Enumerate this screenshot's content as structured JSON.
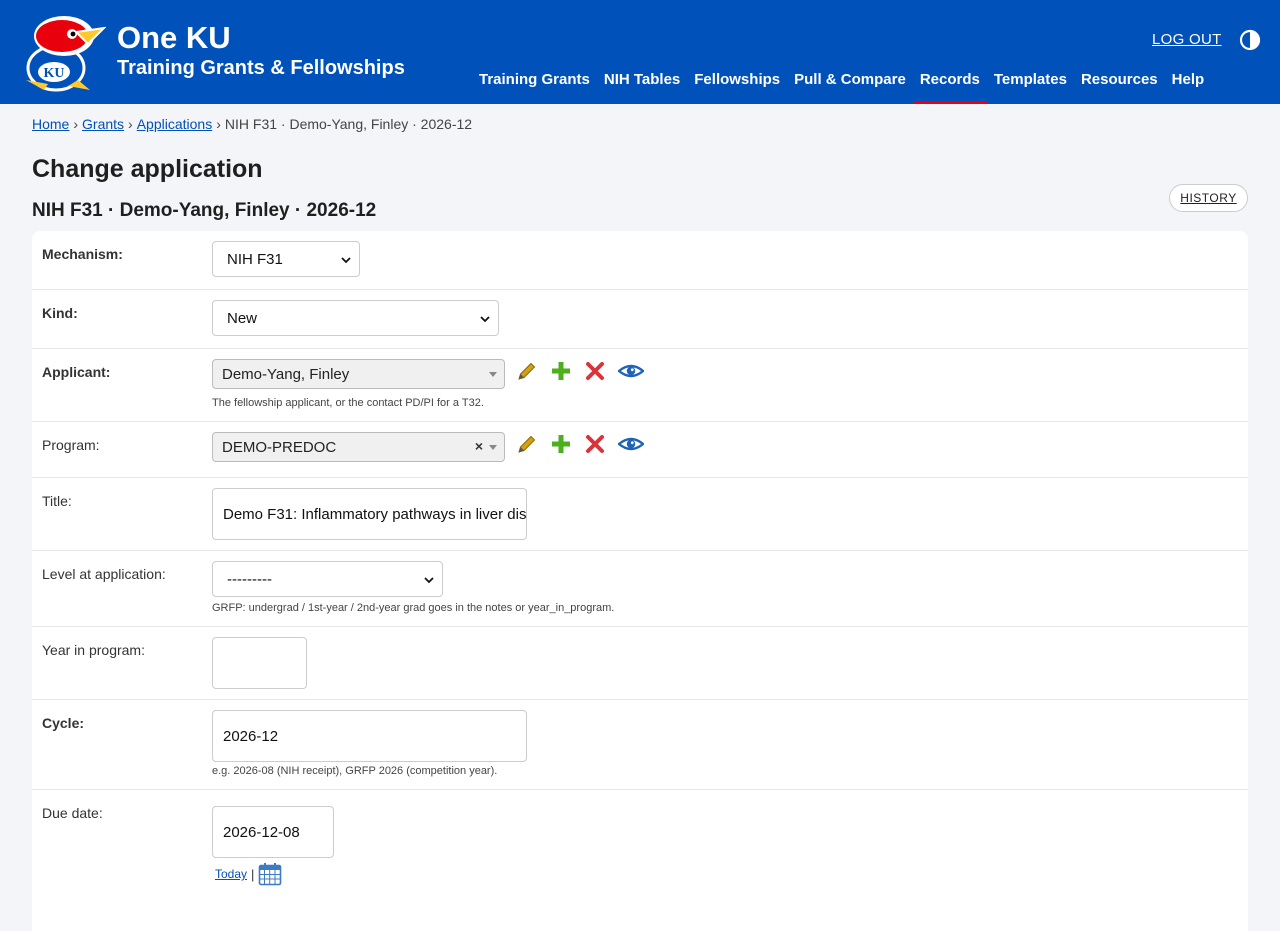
{
  "header": {
    "brand_title": "One KU",
    "brand_subtitle": "Training Grants & Fellowships",
    "logout_label": "LOG OUT",
    "nav": [
      {
        "label": "Training Grants"
      },
      {
        "label": "NIH Tables"
      },
      {
        "label": "Fellowships"
      },
      {
        "label": "Pull & Compare"
      },
      {
        "label": "Records"
      },
      {
        "label": "Templates"
      },
      {
        "label": "Resources"
      },
      {
        "label": "Help"
      }
    ],
    "active_nav": "Records",
    "logo_text": "KU",
    "colors": {
      "brand_blue": "#0051ba",
      "active_underline": "#e8000d"
    }
  },
  "breadcrumb": {
    "home": "Home",
    "grants": "Grants",
    "applications": "Applications",
    "current": "NIH F31 · Demo-Yang, Finley · 2026-12",
    "separator": "›"
  },
  "page": {
    "title": "Change application",
    "subtitle": "NIH F31 · Demo-Yang, Finley · 2026-12",
    "history_label": "HISTORY"
  },
  "form": {
    "mechanism": {
      "label": "Mechanism:",
      "value": "NIH F31"
    },
    "kind": {
      "label": "Kind:",
      "value": "New"
    },
    "applicant": {
      "label": "Applicant:",
      "value": "Demo-Yang, Finley",
      "help": "The fellowship applicant, or the contact PD/PI for a T32."
    },
    "program": {
      "label": "Program:",
      "value": "DEMO-PREDOC",
      "clear": "×"
    },
    "title": {
      "label": "Title:",
      "value": "Demo F31: Inflammatory pathways in liver dis"
    },
    "level": {
      "label": "Level at application:",
      "value": "---------",
      "help": "GRFP: undergrad / 1st-year / 2nd-year grad goes in the notes or year_in_program."
    },
    "year_in_program": {
      "label": "Year in program:",
      "value": ""
    },
    "cycle": {
      "label": "Cycle:",
      "value": "2026-12",
      "help": "e.g. 2026-08 (NIH receipt), GRFP 2026 (competition year)."
    },
    "due_date": {
      "label": "Due date:",
      "value": "2026-12-08",
      "today_label": "Today",
      "divider": "|"
    }
  },
  "icons": {
    "edit": "pencil-icon",
    "add": "plus-icon",
    "delete": "x-icon",
    "view": "eye-icon",
    "calendar": "calendar-icon",
    "contrast": "contrast-icon"
  }
}
